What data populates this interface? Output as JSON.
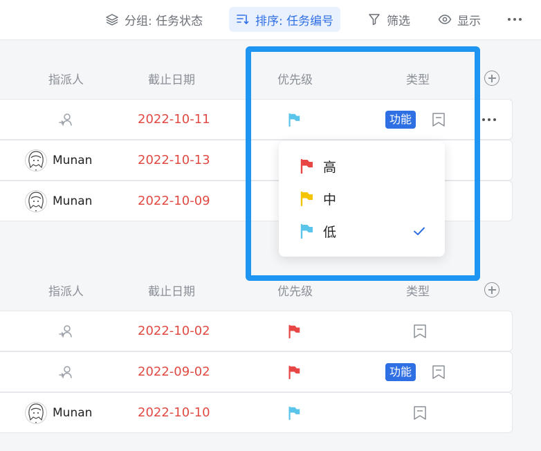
{
  "toolbar": {
    "group_label": "分组: 任务状态",
    "sort_label": "排序: 任务编号",
    "filter_label": "筛选",
    "display_label": "显示"
  },
  "columns": {
    "assignee": "指派人",
    "due_date": "截止日期",
    "priority": "优先级",
    "type": "类型"
  },
  "colors": {
    "accent": "#2f6fe4",
    "date_red": "#e04a43",
    "flag_high": "#e84545",
    "flag_medium": "#f5c400",
    "flag_low": "#5bc4ea",
    "highlight_box": "#1e95f0"
  },
  "group1": {
    "rows": [
      {
        "assignee": "",
        "due": "2022-10-11",
        "priority": "low",
        "type_badge": "功能"
      },
      {
        "assignee": "Munan",
        "due": "2022-10-13"
      },
      {
        "assignee": "Munan",
        "due": "2022-10-09"
      }
    ]
  },
  "group2": {
    "rows": [
      {
        "assignee": "",
        "due": "2022-10-02",
        "priority": "high"
      },
      {
        "assignee": "",
        "due": "2022-09-02",
        "priority": "high",
        "type_badge": "功能"
      },
      {
        "assignee": "Munan",
        "due": "2022-10-10",
        "priority": "low"
      }
    ]
  },
  "priority_menu": {
    "options": [
      {
        "label": "高",
        "flag": "flag-high-icon"
      },
      {
        "label": "中",
        "flag": "flag-medium-icon"
      },
      {
        "label": "低",
        "flag": "flag-low-icon",
        "selected": true
      }
    ]
  }
}
